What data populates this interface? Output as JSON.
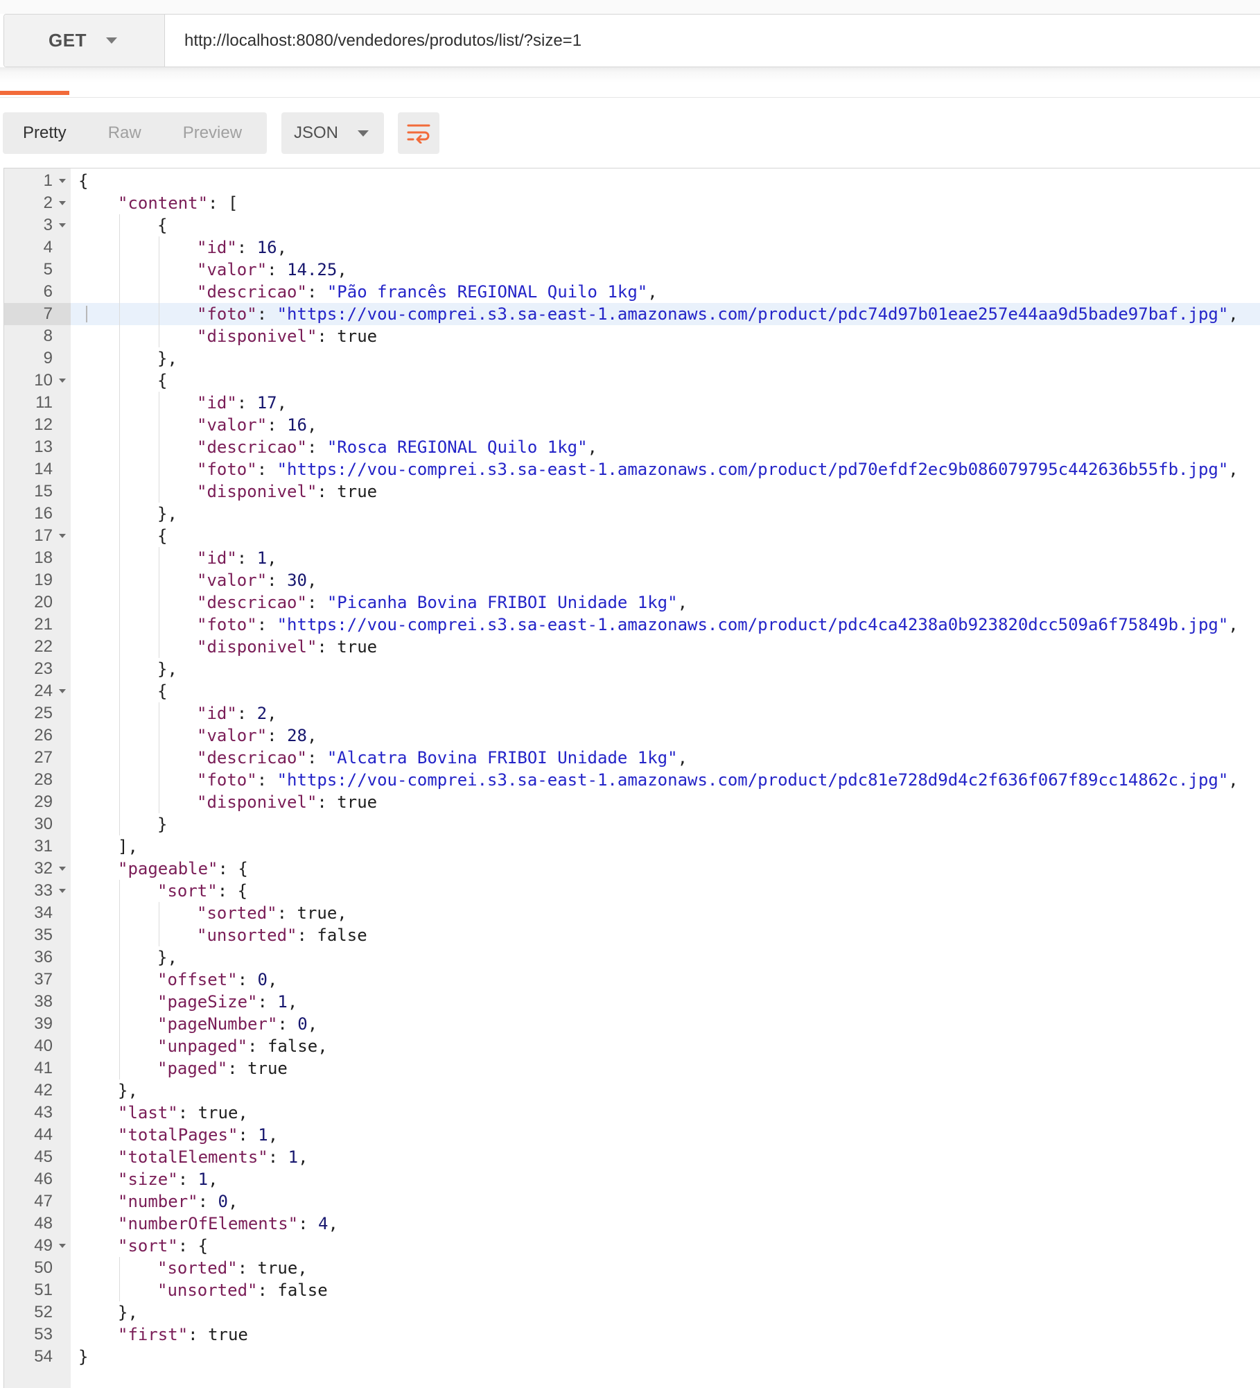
{
  "request": {
    "method": "GET",
    "url": "http://localhost:8080/vendedores/produtos/list/?size=1"
  },
  "response_toolbar": {
    "view_tabs": [
      {
        "label": "Pretty",
        "active": true
      },
      {
        "label": "Raw",
        "active": false
      },
      {
        "label": "Preview",
        "active": false
      }
    ],
    "format": "JSON",
    "wrap_icon": "wrap-lines-icon"
  },
  "colors": {
    "accent": "#f26b3a",
    "json_key": "#7a1d57",
    "json_string": "#2424c8",
    "json_number": "#16166e",
    "highlight_line": "#e9f1fb"
  },
  "editor": {
    "highlighted_line": 7,
    "lines": [
      {
        "n": 1,
        "fold": true,
        "indent": 0,
        "tokens": [
          {
            "t": "p",
            "v": "{"
          }
        ]
      },
      {
        "n": 2,
        "fold": true,
        "indent": 1,
        "tokens": [
          {
            "t": "k",
            "v": "\"content\""
          },
          {
            "t": "p",
            "v": ": ["
          }
        ]
      },
      {
        "n": 3,
        "fold": true,
        "indent": 2,
        "tokens": [
          {
            "t": "p",
            "v": "{"
          }
        ]
      },
      {
        "n": 4,
        "indent": 3,
        "tokens": [
          {
            "t": "k",
            "v": "\"id\""
          },
          {
            "t": "p",
            "v": ": "
          },
          {
            "t": "n",
            "v": "16"
          },
          {
            "t": "p",
            "v": ","
          }
        ]
      },
      {
        "n": 5,
        "indent": 3,
        "tokens": [
          {
            "t": "k",
            "v": "\"valor\""
          },
          {
            "t": "p",
            "v": ": "
          },
          {
            "t": "n",
            "v": "14.25"
          },
          {
            "t": "p",
            "v": ","
          }
        ]
      },
      {
        "n": 6,
        "indent": 3,
        "tokens": [
          {
            "t": "k",
            "v": "\"descricao\""
          },
          {
            "t": "p",
            "v": ": "
          },
          {
            "t": "s",
            "v": "\"Pão francês REGIONAL Quilo 1kg\""
          },
          {
            "t": "p",
            "v": ","
          }
        ]
      },
      {
        "n": 7,
        "indent": 3,
        "tokens": [
          {
            "t": "k",
            "v": "\"foto\""
          },
          {
            "t": "p",
            "v": ": "
          },
          {
            "t": "s",
            "v": "\"https://vou-comprei.s3.sa-east-1.amazonaws.com/product/pdc74d97b01eae257e44aa9d5bade97baf.jpg\""
          },
          {
            "t": "p",
            "v": ","
          }
        ]
      },
      {
        "n": 8,
        "indent": 3,
        "tokens": [
          {
            "t": "k",
            "v": "\"disponivel\""
          },
          {
            "t": "p",
            "v": ": "
          },
          {
            "t": "b",
            "v": "true"
          }
        ]
      },
      {
        "n": 9,
        "indent": 2,
        "tokens": [
          {
            "t": "p",
            "v": "},"
          }
        ]
      },
      {
        "n": 10,
        "fold": true,
        "indent": 2,
        "tokens": [
          {
            "t": "p",
            "v": "{"
          }
        ]
      },
      {
        "n": 11,
        "indent": 3,
        "tokens": [
          {
            "t": "k",
            "v": "\"id\""
          },
          {
            "t": "p",
            "v": ": "
          },
          {
            "t": "n",
            "v": "17"
          },
          {
            "t": "p",
            "v": ","
          }
        ]
      },
      {
        "n": 12,
        "indent": 3,
        "tokens": [
          {
            "t": "k",
            "v": "\"valor\""
          },
          {
            "t": "p",
            "v": ": "
          },
          {
            "t": "n",
            "v": "16"
          },
          {
            "t": "p",
            "v": ","
          }
        ]
      },
      {
        "n": 13,
        "indent": 3,
        "tokens": [
          {
            "t": "k",
            "v": "\"descricao\""
          },
          {
            "t": "p",
            "v": ": "
          },
          {
            "t": "s",
            "v": "\"Rosca REGIONAL Quilo 1kg\""
          },
          {
            "t": "p",
            "v": ","
          }
        ]
      },
      {
        "n": 14,
        "indent": 3,
        "tokens": [
          {
            "t": "k",
            "v": "\"foto\""
          },
          {
            "t": "p",
            "v": ": "
          },
          {
            "t": "s",
            "v": "\"https://vou-comprei.s3.sa-east-1.amazonaws.com/product/pd70efdf2ec9b086079795c442636b55fb.jpg\""
          },
          {
            "t": "p",
            "v": ","
          }
        ]
      },
      {
        "n": 15,
        "indent": 3,
        "tokens": [
          {
            "t": "k",
            "v": "\"disponivel\""
          },
          {
            "t": "p",
            "v": ": "
          },
          {
            "t": "b",
            "v": "true"
          }
        ]
      },
      {
        "n": 16,
        "indent": 2,
        "tokens": [
          {
            "t": "p",
            "v": "},"
          }
        ]
      },
      {
        "n": 17,
        "fold": true,
        "indent": 2,
        "tokens": [
          {
            "t": "p",
            "v": "{"
          }
        ]
      },
      {
        "n": 18,
        "indent": 3,
        "tokens": [
          {
            "t": "k",
            "v": "\"id\""
          },
          {
            "t": "p",
            "v": ": "
          },
          {
            "t": "n",
            "v": "1"
          },
          {
            "t": "p",
            "v": ","
          }
        ]
      },
      {
        "n": 19,
        "indent": 3,
        "tokens": [
          {
            "t": "k",
            "v": "\"valor\""
          },
          {
            "t": "p",
            "v": ": "
          },
          {
            "t": "n",
            "v": "30"
          },
          {
            "t": "p",
            "v": ","
          }
        ]
      },
      {
        "n": 20,
        "indent": 3,
        "tokens": [
          {
            "t": "k",
            "v": "\"descricao\""
          },
          {
            "t": "p",
            "v": ": "
          },
          {
            "t": "s",
            "v": "\"Picanha Bovina FRIBOI Unidade 1kg\""
          },
          {
            "t": "p",
            "v": ","
          }
        ]
      },
      {
        "n": 21,
        "indent": 3,
        "tokens": [
          {
            "t": "k",
            "v": "\"foto\""
          },
          {
            "t": "p",
            "v": ": "
          },
          {
            "t": "s",
            "v": "\"https://vou-comprei.s3.sa-east-1.amazonaws.com/product/pdc4ca4238a0b923820dcc509a6f75849b.jpg\""
          },
          {
            "t": "p",
            "v": ","
          }
        ]
      },
      {
        "n": 22,
        "indent": 3,
        "tokens": [
          {
            "t": "k",
            "v": "\"disponivel\""
          },
          {
            "t": "p",
            "v": ": "
          },
          {
            "t": "b",
            "v": "true"
          }
        ]
      },
      {
        "n": 23,
        "indent": 2,
        "tokens": [
          {
            "t": "p",
            "v": "},"
          }
        ]
      },
      {
        "n": 24,
        "fold": true,
        "indent": 2,
        "tokens": [
          {
            "t": "p",
            "v": "{"
          }
        ]
      },
      {
        "n": 25,
        "indent": 3,
        "tokens": [
          {
            "t": "k",
            "v": "\"id\""
          },
          {
            "t": "p",
            "v": ": "
          },
          {
            "t": "n",
            "v": "2"
          },
          {
            "t": "p",
            "v": ","
          }
        ]
      },
      {
        "n": 26,
        "indent": 3,
        "tokens": [
          {
            "t": "k",
            "v": "\"valor\""
          },
          {
            "t": "p",
            "v": ": "
          },
          {
            "t": "n",
            "v": "28"
          },
          {
            "t": "p",
            "v": ","
          }
        ]
      },
      {
        "n": 27,
        "indent": 3,
        "tokens": [
          {
            "t": "k",
            "v": "\"descricao\""
          },
          {
            "t": "p",
            "v": ": "
          },
          {
            "t": "s",
            "v": "\"Alcatra Bovina FRIBOI Unidade 1kg\""
          },
          {
            "t": "p",
            "v": ","
          }
        ]
      },
      {
        "n": 28,
        "indent": 3,
        "tokens": [
          {
            "t": "k",
            "v": "\"foto\""
          },
          {
            "t": "p",
            "v": ": "
          },
          {
            "t": "s",
            "v": "\"https://vou-comprei.s3.sa-east-1.amazonaws.com/product/pdc81e728d9d4c2f636f067f89cc14862c.jpg\""
          },
          {
            "t": "p",
            "v": ","
          }
        ]
      },
      {
        "n": 29,
        "indent": 3,
        "tokens": [
          {
            "t": "k",
            "v": "\"disponivel\""
          },
          {
            "t": "p",
            "v": ": "
          },
          {
            "t": "b",
            "v": "true"
          }
        ]
      },
      {
        "n": 30,
        "indent": 2,
        "tokens": [
          {
            "t": "p",
            "v": "}"
          }
        ]
      },
      {
        "n": 31,
        "indent": 1,
        "tokens": [
          {
            "t": "p",
            "v": "],"
          }
        ]
      },
      {
        "n": 32,
        "fold": true,
        "indent": 1,
        "tokens": [
          {
            "t": "k",
            "v": "\"pageable\""
          },
          {
            "t": "p",
            "v": ": {"
          }
        ]
      },
      {
        "n": 33,
        "fold": true,
        "indent": 2,
        "tokens": [
          {
            "t": "k",
            "v": "\"sort\""
          },
          {
            "t": "p",
            "v": ": {"
          }
        ]
      },
      {
        "n": 34,
        "indent": 3,
        "tokens": [
          {
            "t": "k",
            "v": "\"sorted\""
          },
          {
            "t": "p",
            "v": ": "
          },
          {
            "t": "b",
            "v": "true"
          },
          {
            "t": "p",
            "v": ","
          }
        ]
      },
      {
        "n": 35,
        "indent": 3,
        "tokens": [
          {
            "t": "k",
            "v": "\"unsorted\""
          },
          {
            "t": "p",
            "v": ": "
          },
          {
            "t": "b",
            "v": "false"
          }
        ]
      },
      {
        "n": 36,
        "indent": 2,
        "tokens": [
          {
            "t": "p",
            "v": "},"
          }
        ]
      },
      {
        "n": 37,
        "indent": 2,
        "tokens": [
          {
            "t": "k",
            "v": "\"offset\""
          },
          {
            "t": "p",
            "v": ": "
          },
          {
            "t": "n",
            "v": "0"
          },
          {
            "t": "p",
            "v": ","
          }
        ]
      },
      {
        "n": 38,
        "indent": 2,
        "tokens": [
          {
            "t": "k",
            "v": "\"pageSize\""
          },
          {
            "t": "p",
            "v": ": "
          },
          {
            "t": "n",
            "v": "1"
          },
          {
            "t": "p",
            "v": ","
          }
        ]
      },
      {
        "n": 39,
        "indent": 2,
        "tokens": [
          {
            "t": "k",
            "v": "\"pageNumber\""
          },
          {
            "t": "p",
            "v": ": "
          },
          {
            "t": "n",
            "v": "0"
          },
          {
            "t": "p",
            "v": ","
          }
        ]
      },
      {
        "n": 40,
        "indent": 2,
        "tokens": [
          {
            "t": "k",
            "v": "\"unpaged\""
          },
          {
            "t": "p",
            "v": ": "
          },
          {
            "t": "b",
            "v": "false"
          },
          {
            "t": "p",
            "v": ","
          }
        ]
      },
      {
        "n": 41,
        "indent": 2,
        "tokens": [
          {
            "t": "k",
            "v": "\"paged\""
          },
          {
            "t": "p",
            "v": ": "
          },
          {
            "t": "b",
            "v": "true"
          }
        ]
      },
      {
        "n": 42,
        "indent": 1,
        "tokens": [
          {
            "t": "p",
            "v": "},"
          }
        ]
      },
      {
        "n": 43,
        "indent": 1,
        "tokens": [
          {
            "t": "k",
            "v": "\"last\""
          },
          {
            "t": "p",
            "v": ": "
          },
          {
            "t": "b",
            "v": "true"
          },
          {
            "t": "p",
            "v": ","
          }
        ]
      },
      {
        "n": 44,
        "indent": 1,
        "tokens": [
          {
            "t": "k",
            "v": "\"totalPages\""
          },
          {
            "t": "p",
            "v": ": "
          },
          {
            "t": "n",
            "v": "1"
          },
          {
            "t": "p",
            "v": ","
          }
        ]
      },
      {
        "n": 45,
        "indent": 1,
        "tokens": [
          {
            "t": "k",
            "v": "\"totalElements\""
          },
          {
            "t": "p",
            "v": ": "
          },
          {
            "t": "n",
            "v": "1"
          },
          {
            "t": "p",
            "v": ","
          }
        ]
      },
      {
        "n": 46,
        "indent": 1,
        "tokens": [
          {
            "t": "k",
            "v": "\"size\""
          },
          {
            "t": "p",
            "v": ": "
          },
          {
            "t": "n",
            "v": "1"
          },
          {
            "t": "p",
            "v": ","
          }
        ]
      },
      {
        "n": 47,
        "indent": 1,
        "tokens": [
          {
            "t": "k",
            "v": "\"number\""
          },
          {
            "t": "p",
            "v": ": "
          },
          {
            "t": "n",
            "v": "0"
          },
          {
            "t": "p",
            "v": ","
          }
        ]
      },
      {
        "n": 48,
        "indent": 1,
        "tokens": [
          {
            "t": "k",
            "v": "\"numberOfElements\""
          },
          {
            "t": "p",
            "v": ": "
          },
          {
            "t": "n",
            "v": "4"
          },
          {
            "t": "p",
            "v": ","
          }
        ]
      },
      {
        "n": 49,
        "fold": true,
        "indent": 1,
        "tokens": [
          {
            "t": "k",
            "v": "\"sort\""
          },
          {
            "t": "p",
            "v": ": {"
          }
        ]
      },
      {
        "n": 50,
        "indent": 2,
        "tokens": [
          {
            "t": "k",
            "v": "\"sorted\""
          },
          {
            "t": "p",
            "v": ": "
          },
          {
            "t": "b",
            "v": "true"
          },
          {
            "t": "p",
            "v": ","
          }
        ]
      },
      {
        "n": 51,
        "indent": 2,
        "tokens": [
          {
            "t": "k",
            "v": "\"unsorted\""
          },
          {
            "t": "p",
            "v": ": "
          },
          {
            "t": "b",
            "v": "false"
          }
        ]
      },
      {
        "n": 52,
        "indent": 1,
        "tokens": [
          {
            "t": "p",
            "v": "},"
          }
        ]
      },
      {
        "n": 53,
        "indent": 1,
        "tokens": [
          {
            "t": "k",
            "v": "\"first\""
          },
          {
            "t": "p",
            "v": ": "
          },
          {
            "t": "b",
            "v": "true"
          }
        ]
      },
      {
        "n": 54,
        "indent": 0,
        "tokens": [
          {
            "t": "p",
            "v": "}"
          }
        ]
      }
    ]
  }
}
